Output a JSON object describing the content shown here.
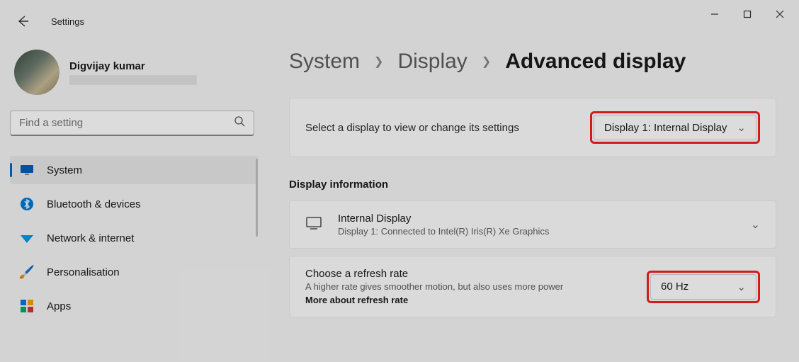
{
  "app": {
    "title": "Settings"
  },
  "user": {
    "name": "Digvijay kumar"
  },
  "search": {
    "placeholder": "Find a setting"
  },
  "nav": {
    "items": [
      {
        "label": "System"
      },
      {
        "label": "Bluetooth & devices"
      },
      {
        "label": "Network & internet"
      },
      {
        "label": "Personalisation"
      },
      {
        "label": "Apps"
      }
    ]
  },
  "breadcrumb": {
    "parts": [
      "System",
      "Display",
      "Advanced display"
    ]
  },
  "display": {
    "select_label": "Select a display to view or change its settings",
    "selected": "Display 1: Internal Display",
    "info_heading": "Display information",
    "info_title": "Internal Display",
    "info_sub": "Display 1: Connected to Intel(R) Iris(R) Xe Graphics",
    "refresh_title": "Choose a refresh rate",
    "refresh_sub": "A higher rate gives smoother motion, but also uses more power",
    "refresh_link": "More about refresh rate",
    "refresh_value": "60 Hz"
  }
}
